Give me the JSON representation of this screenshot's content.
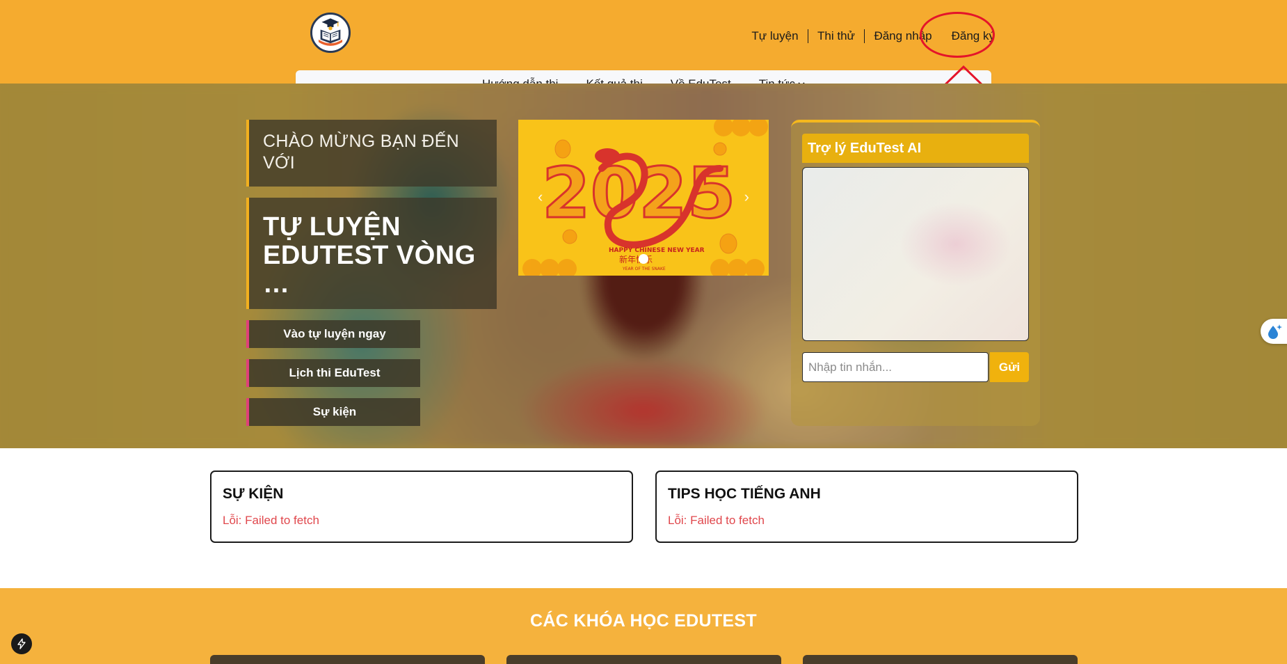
{
  "header": {
    "logo_icon": "graduation-book-logo",
    "top_links": [
      "Tự luyện",
      "Thi thử",
      "Đăng nhập",
      "Đăng ký"
    ],
    "sub_nav": [
      "Hướng dẫn thi",
      "Kết quả thi",
      "Về EduTest",
      "Tin tức"
    ],
    "highlight_color": "#e4142a"
  },
  "hero": {
    "welcome": "CHÀO MỪNG BẠN ĐẾN VỚI",
    "headline": "TỰ LUYỆN EDUTEST VÒNG …",
    "buttons": [
      "Vào tự luyện ngay",
      "Lịch thi EduTest",
      "Sự kiện"
    ],
    "banner": {
      "year": "2025",
      "caption": "HAPPY CHINESE NEW YEAR",
      "chinese": "新年快乐",
      "subcaption": "YEAR OF THE SNAKE"
    }
  },
  "chat": {
    "title": "Trợ lý EduTest AI",
    "input_placeholder": "Nhập tin nhắn...",
    "send_label": "Gửi"
  },
  "cards": [
    {
      "title": "SỰ KIỆN",
      "error": "Lỗi: Failed to fetch"
    },
    {
      "title": "TIPS HỌC TIẾNG ANH",
      "error": "Lỗi: Failed to fetch"
    }
  ],
  "courses": {
    "title": "CÁC KHÓA HỌC EDUTEST"
  },
  "colors": {
    "header_bg": "#f5ab2f",
    "accent_yellow": "#f2b01e",
    "button_accent": "#e0407a",
    "error_red": "#e0474c"
  }
}
